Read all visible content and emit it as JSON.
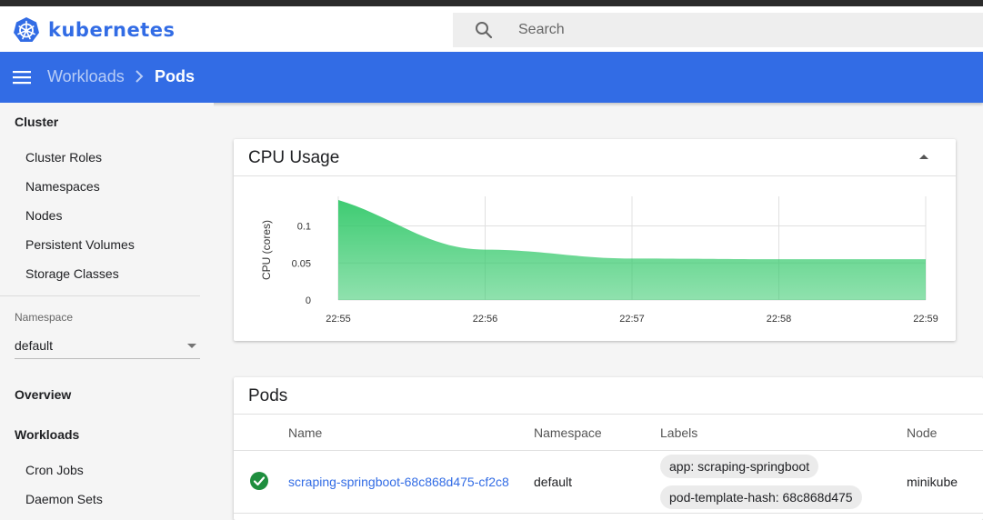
{
  "header": {
    "brand": "kubernetes",
    "search_placeholder": "Search"
  },
  "toolbar": {
    "breadcrumb_parent": "Workloads",
    "breadcrumb_current": "Pods"
  },
  "sidebar": {
    "cluster_heading": "Cluster",
    "cluster_items": [
      "Cluster Roles",
      "Namespaces",
      "Nodes",
      "Persistent Volumes",
      "Storage Classes"
    ],
    "namespace_label": "Namespace",
    "namespace_value": "default",
    "overview": "Overview",
    "workloads_heading": "Workloads",
    "workload_items": [
      "Cron Jobs",
      "Daemon Sets"
    ]
  },
  "cpu_card": {
    "title": "CPU Usage"
  },
  "chart_data": {
    "type": "area",
    "title": "CPU Usage",
    "ylabel": "CPU (cores)",
    "xlabel": "",
    "x": [
      "22:55",
      "22:56",
      "22:57",
      "22:58",
      "22:59"
    ],
    "y": [
      0.135,
      0.068,
      0.056,
      0.055,
      0.055
    ],
    "y_ticks": [
      "0",
      "0.05",
      "0.1"
    ],
    "ylim": [
      0,
      0.135
    ],
    "grid": true,
    "color": "#34c96b"
  },
  "pods_card": {
    "title": "Pods",
    "columns": [
      "Name",
      "Namespace",
      "Labels",
      "Node"
    ],
    "rows": [
      {
        "status": "running",
        "name": "scraping-springboot-68c868d475-cf2c8",
        "namespace": "default",
        "labels": [
          "app: scraping-springboot",
          "pod-template-hash: 68c868d475"
        ],
        "node": "minikube"
      }
    ]
  },
  "colors": {
    "brand": "#326ce5",
    "success": "#1e8e3e",
    "area_fill": "#34c96b"
  }
}
